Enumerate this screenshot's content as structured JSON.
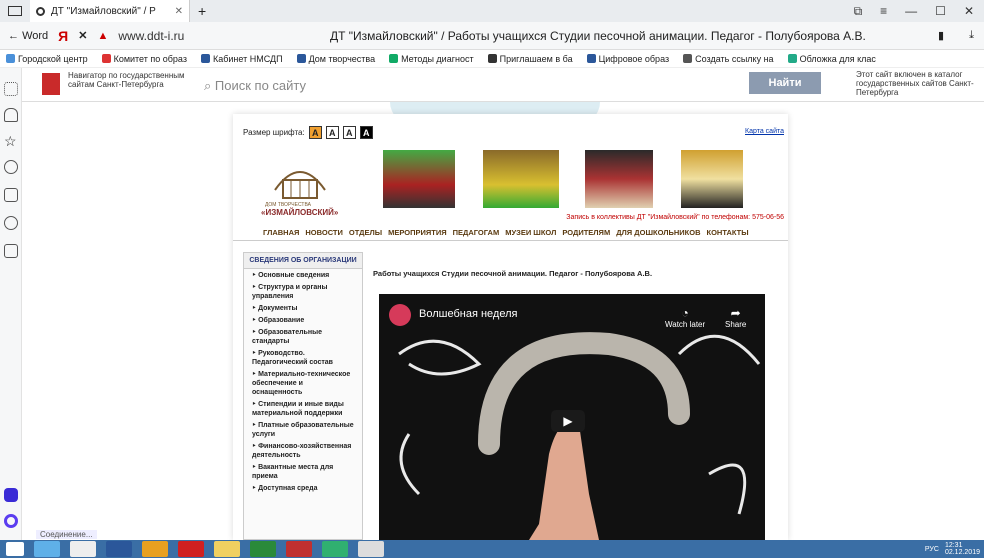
{
  "browser": {
    "tab_title": "ДТ \"Измайловский\" / Р",
    "back_label": "Word",
    "ya_label": "Я",
    "url": "www.ddt-i.ru",
    "page_title": "ДТ \"Измайловский\" / Работы учащихся Студии песочной анимации. Педагог - Полубоярова А.В.",
    "bookmarks": [
      "Городской центр",
      "Комитет по образ",
      "Кабинет НМСДП",
      "Дом творчества",
      "Методы диагност",
      "Приглашаем в ба",
      "Цифровое образ",
      "Создать ссылку на",
      "Обложка для клас"
    ],
    "status_text": "Соединение..."
  },
  "gov_header": {
    "navigator_text": "Навигатор по государственным сайтам Санкт-Петербурга",
    "search_placeholder": "Поиск по сайту",
    "search_button": "Найти",
    "catalog_text": "Этот сайт включен в каталог государственных сайтов Санкт-Петербурга"
  },
  "site": {
    "font_size_label": "Размер шрифта:",
    "font_sizes": [
      "A",
      "A",
      "A",
      "A"
    ],
    "sitemap_link": "Карта сайта",
    "crest_name": "«ИЗМАЙЛОВСКИЙ»",
    "crest_sub": "ДОМ ТВОРЧЕСТВА",
    "phone_line": "Запись в коллективы ДТ \"Измайловский\" по телефонам: 575-06-56",
    "nav": [
      "ГЛАВНАЯ",
      "НОВОСТИ",
      "ОТДЕЛЫ",
      "МЕРОПРИЯТИЯ",
      "ПЕДАГОГАМ",
      "МУЗЕИ ШКОЛ",
      "РОДИТЕЛЯМ",
      "ДЛЯ ДОШКОЛЬНИКОВ",
      "КОНТАКТЫ"
    ],
    "left_menu_header": "СВЕДЕНИЯ ОБ ОРГАНИЗАЦИИ",
    "left_menu": [
      "Основные сведения",
      "Структура и органы управления",
      "Документы",
      "Образование",
      "Образовательные стандарты",
      "Руководство. Педагогический состав",
      "Материально-техническое обеспечение и оснащенность",
      "Стипендии и иные виды материальной поддержки",
      "Платные образовательные услуги",
      "Финансово-хозяйственная деятельность",
      "Вакантные места для приема",
      "Доступная среда"
    ],
    "content_title": "Работы учащихся Студии песочной анимации. Педагог - Полубоярова А.В.",
    "video": {
      "title": "Волшебная неделя",
      "watch_later": "Watch later",
      "share": "Share"
    }
  },
  "taskbar": {
    "lang": "РУС",
    "time": "12:31",
    "date": "02.12.2019"
  },
  "colors": {
    "accent_red": "#c00000",
    "nav_brown": "#5a3a10",
    "taskbar": "#3a6ea5"
  }
}
